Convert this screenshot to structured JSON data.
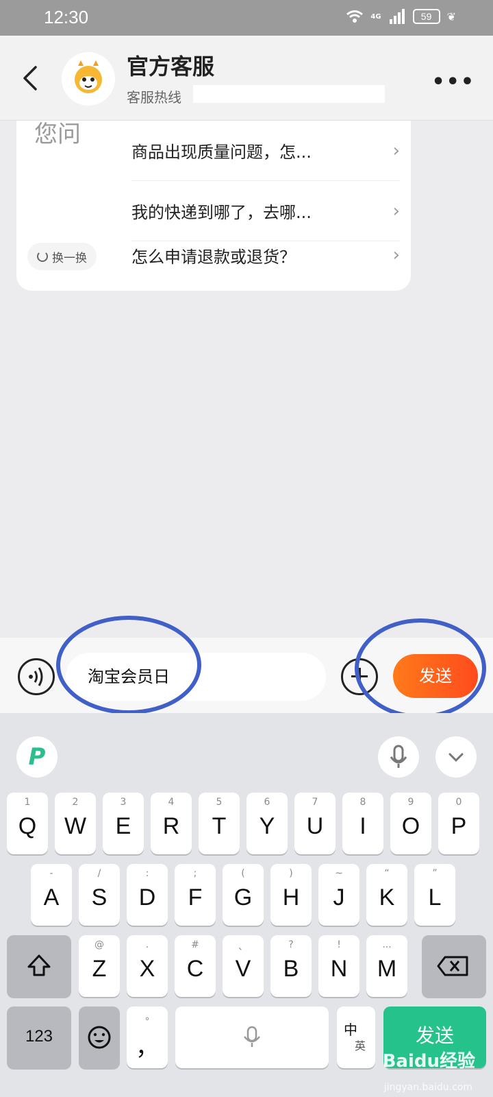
{
  "status_bar": {
    "time": "12:30",
    "network": "4G",
    "battery": "59"
  },
  "header": {
    "title": "官方客服",
    "subtitle": "客服热线"
  },
  "card": {
    "partial_text": "您问",
    "swap_label": "换一换",
    "questions": [
      {
        "label": "商品出现质量问题，怎..."
      },
      {
        "label": "我的快递到哪了，去哪..."
      },
      {
        "label": "怎么申请退款或退货？"
      }
    ]
  },
  "input": {
    "value": "淘宝会员日",
    "send_label": "发送"
  },
  "keyboard": {
    "row1": [
      {
        "hint": "1",
        "key": "Q"
      },
      {
        "hint": "2",
        "key": "W"
      },
      {
        "hint": "3",
        "key": "E"
      },
      {
        "hint": "4",
        "key": "R"
      },
      {
        "hint": "5",
        "key": "T"
      },
      {
        "hint": "6",
        "key": "Y"
      },
      {
        "hint": "7",
        "key": "U"
      },
      {
        "hint": "8",
        "key": "I"
      },
      {
        "hint": "9",
        "key": "O"
      },
      {
        "hint": "0",
        "key": "P"
      }
    ],
    "row2": [
      {
        "hint": "-",
        "key": "A"
      },
      {
        "hint": "/",
        "key": "S"
      },
      {
        "hint": ":",
        "key": "D"
      },
      {
        "hint": ";",
        "key": "F"
      },
      {
        "hint": "(",
        "key": "G"
      },
      {
        "hint": ")",
        "key": "H"
      },
      {
        "hint": "~",
        "key": "J"
      },
      {
        "hint": "“",
        "key": "K"
      },
      {
        "hint": "”",
        "key": "L"
      }
    ],
    "row3": [
      {
        "hint": "@",
        "key": "Z"
      },
      {
        "hint": ".",
        "key": "X"
      },
      {
        "hint": "#",
        "key": "C"
      },
      {
        "hint": "、",
        "key": "V"
      },
      {
        "hint": "?",
        "key": "B"
      },
      {
        "hint": "!",
        "key": "N"
      },
      {
        "hint": "...",
        "key": "M"
      }
    ],
    "num_label": "123",
    "comma_hint": "°",
    "comma_key": "，",
    "lang_top": "中",
    "lang_bottom": "英",
    "send_label": "发送"
  },
  "watermark": {
    "brand": "Baidu经验",
    "url": "jingyan.baidu.com"
  }
}
